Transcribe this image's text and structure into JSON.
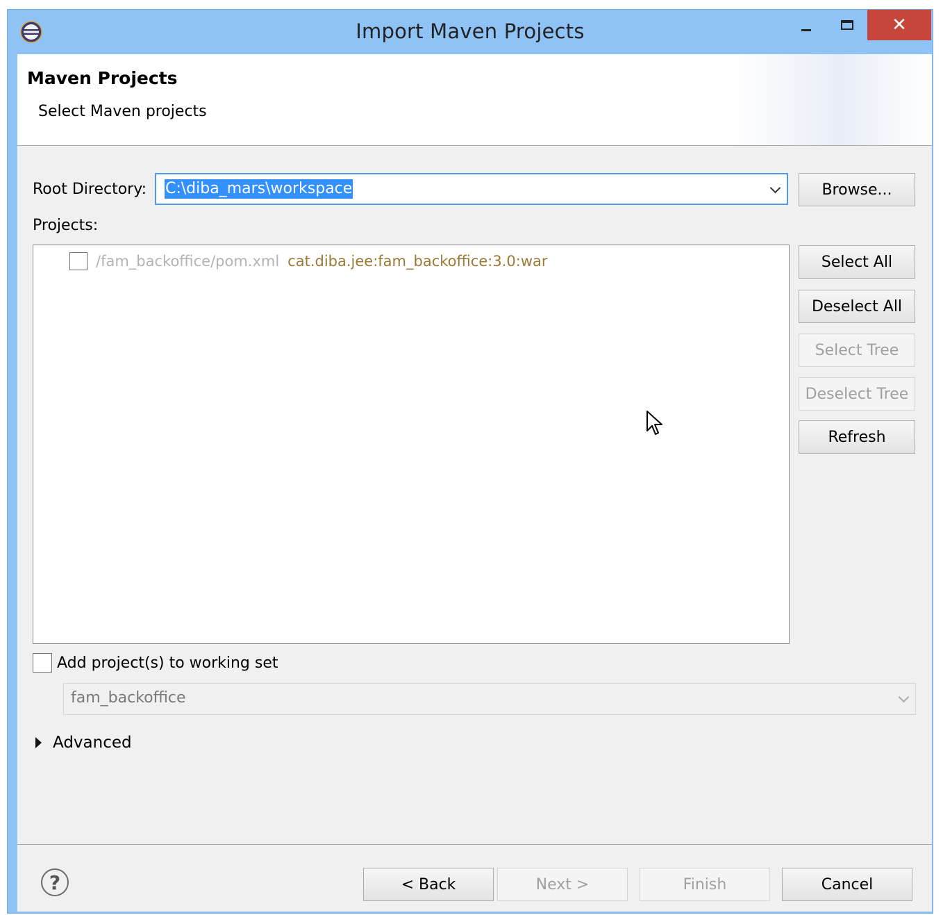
{
  "window": {
    "title": "Import Maven Projects",
    "app_icon": "eclipse-icon",
    "close_glyph": "✕"
  },
  "header": {
    "title": "Maven Projects",
    "subtitle": "Select Maven projects"
  },
  "root_directory": {
    "label": "Root Directory:",
    "value": "C:\\diba_mars\\workspace",
    "browse_label": "Browse..."
  },
  "projects": {
    "label": "Projects:",
    "items": [
      {
        "path": "/fam_backoffice/pom.xml",
        "gav": "cat.diba.jee:fam_backoffice:3.0:war",
        "checked": false
      }
    ]
  },
  "side_buttons": {
    "select_all": "Select All",
    "deselect_all": "Deselect All",
    "select_tree": "Select Tree",
    "deselect_tree": "Deselect Tree",
    "refresh": "Refresh"
  },
  "working_set": {
    "checkbox_label": "Add project(s) to working set",
    "checked": false,
    "value": "fam_backoffice"
  },
  "advanced": {
    "label": "Advanced"
  },
  "footer": {
    "help_glyph": "?",
    "back": "< Back",
    "next": "Next >",
    "finish": "Finish",
    "cancel": "Cancel"
  },
  "colors": {
    "titlebar": "#8fc3f5",
    "close_button": "#c7463b",
    "selection": "#3390ff",
    "gav_text": "#9c7a36"
  }
}
